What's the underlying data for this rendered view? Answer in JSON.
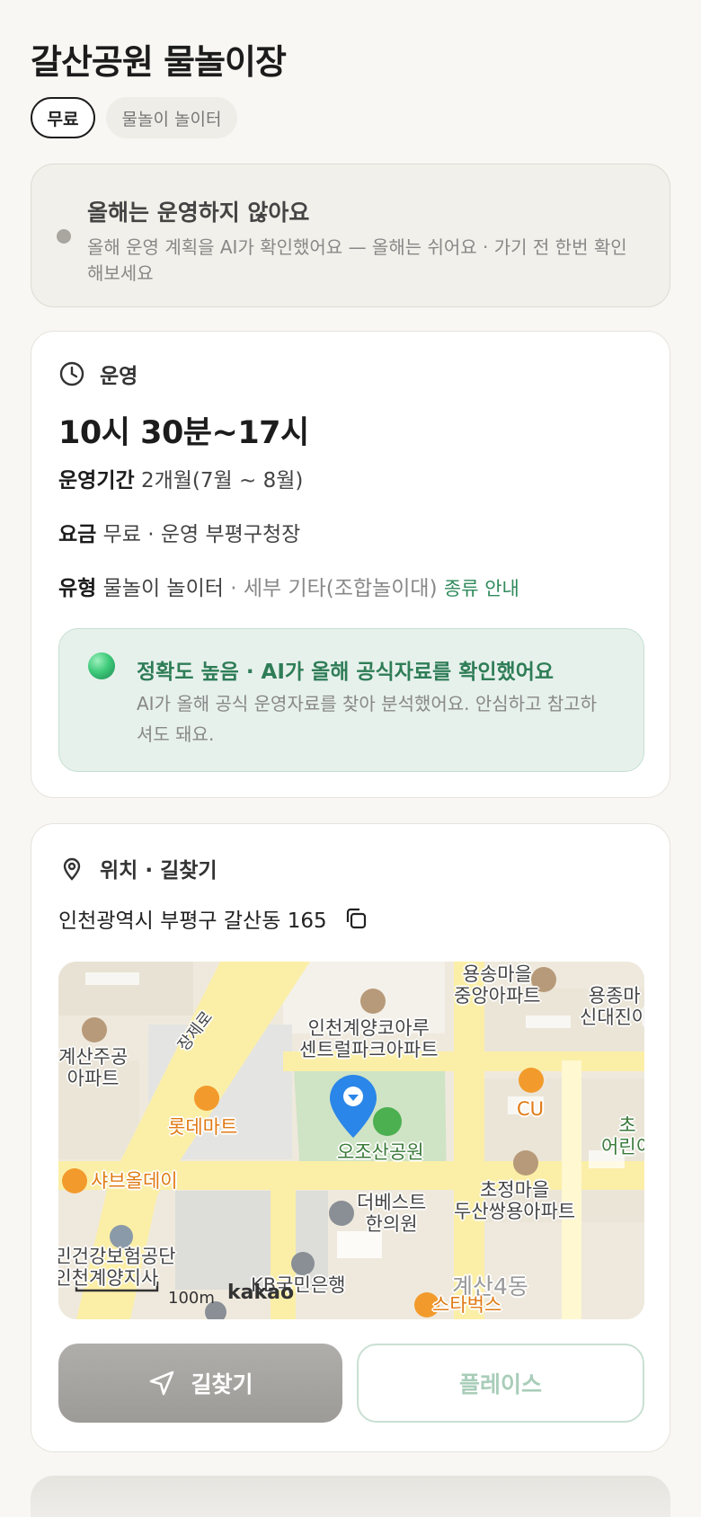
{
  "header": {
    "title": "갈산공원 물놀이장",
    "chips": [
      "무료",
      "물놀이 놀이터"
    ]
  },
  "notice": {
    "title": "올해는 운영하지 않아요",
    "description": "올해 운영 계획을 AI가 확인했어요 — 올해는 쉬어요 · 가기 전 한번 확인해보세요"
  },
  "hours": {
    "section_label": "운영",
    "time": "10시 30분~17시",
    "period_label": "운영기간",
    "period_value": "2개월(7월 ~ 8월)",
    "fee_label": "요금",
    "fee_value": "무료 · 운영 부평구청장",
    "type_label": "유형",
    "type_value": "물놀이 놀이터",
    "type_detail": "· 세부 기타(조합놀이대)",
    "type_link": "종류 안내"
  },
  "accuracy": {
    "title": "정확도 높음 · AI가 올해 공식자료를 확인했어요",
    "description": "AI가 올해 공식 운영자료를 찾아 분석했어요. 안심하고 참고하셔도 돼요."
  },
  "location": {
    "section_label": "위치 · 길찾기",
    "address": "인천광역시 부평구 갈산동 165",
    "map": {
      "labels": {
        "yongsong": "용송마을\n중앙아파트",
        "yongjong": "용종마\n신대진아",
        "central_park": "인천계양코아루\n센트럴파크아파트",
        "gyesan": "계산주공\n아파트",
        "jangje": "장제로",
        "lotte": "롯데마트",
        "park": "오조산공원",
        "cu": "CU",
        "cho": "초\n어린이",
        "shabu": "샤브올데이",
        "clinic": "더베스트\n한의원",
        "chojeong": "초정마을\n두산쌍용아파트",
        "nhis": "국민건강보험공단\n인천계양지사",
        "kb": "KB국민은행",
        "dong": "계산4동",
        "starbucks": "스타벅스",
        "scale": "100m",
        "kakao": "kakao"
      }
    },
    "route_button": "길찾기",
    "place_button": "플레이스"
  },
  "colors": {
    "accent_green": "#2f8a5c",
    "pin_blue": "#2a86e8",
    "background": "#f8f7f3"
  }
}
